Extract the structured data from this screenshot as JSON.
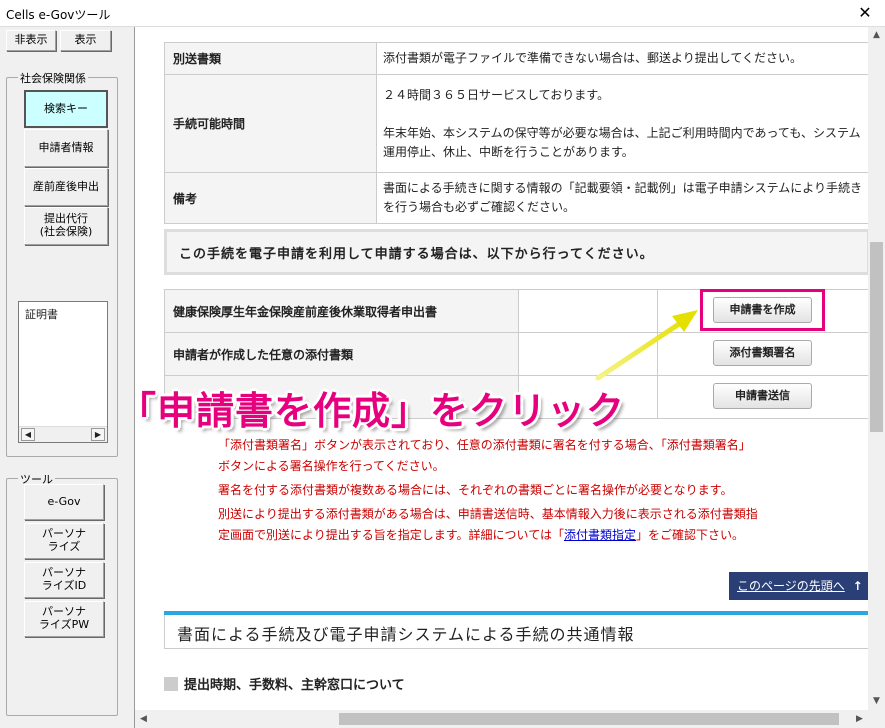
{
  "window": {
    "title": "Cells e-Govツール",
    "close_glyph": "✕"
  },
  "sidebar": {
    "top_buttons": [
      "非表示",
      "表示"
    ],
    "group1_label": "社会保険関係",
    "group1_items": [
      "検索キー",
      "申請者情報",
      "産前産後申出",
      "提出代行\n(社会保険)"
    ],
    "list_item": "証明書",
    "group2_label": "ツール",
    "group2_items": [
      "e-Gov",
      "パーソナ\nライズ",
      "パーソナ\nライズID",
      "パーソナ\nライズPW"
    ]
  },
  "table1": [
    {
      "header": "別送書類",
      "value": "添付書類が電子ファイルで準備できない場合は、郵送より提出してください。"
    },
    {
      "header": "手続可能時間",
      "value_lines": [
        "２４時間３６５日サービスしております。",
        "",
        "年末年始、本システムの保守等が必要な場合は、上記ご利用時間内であっても、システム運用停止、休止、中断を行うことがあります。"
      ]
    },
    {
      "header": "備考",
      "value": "書面による手続きに関する情報の「記載要領・記載例」は電子申請システムにより手続きを行う場合も必ずご確認ください。"
    }
  ],
  "notice": "この手続を電子申請を利用して申請する場合は、以下から行ってください。",
  "table2": [
    {
      "header": "健康保険厚生年金保険産前産後休業取得者申出書",
      "button": "申請書を作成"
    },
    {
      "header": "申請者が作成した任意の添付書類",
      "button": "添付書類署名"
    },
    {
      "header": "",
      "button": "申請書送信"
    }
  ],
  "caption": "「申請書を作成」をクリック",
  "notes": {
    "line1": "「添付書類署名」ボタンが表示されており、任意の添付書類に署名を付する場合、「添付書類署名」",
    "line2": "ボタンによる署名操作を行ってください。",
    "line3": "署名を付する添付書類が複数ある場合には、それぞれの書類ごとに署名操作が必要となります。",
    "line4": "別送により提出する添付書類がある場合は、申請書送信時、基本情報入力後に表示される添付書類指",
    "line5_pre": "定画面で別送により提出する旨を指定します。詳細については「",
    "line5_link": "添付書類指定",
    "line5_post": "」をご確認下さい。"
  },
  "page_top_link": "このページの先頭へ",
  "page_top_icon": "arrow-up-icon",
  "section_title": "書面による手続及び電子申請システムによる手続の共通情報",
  "sub_title": "提出時期、手数料、主幹窓口について",
  "colors": {
    "accent": "#e6007e",
    "note_red": "#cc0000",
    "link_bar": "#2b3f77",
    "section_line": "#29a8e0",
    "active_button": "#ccffff"
  }
}
